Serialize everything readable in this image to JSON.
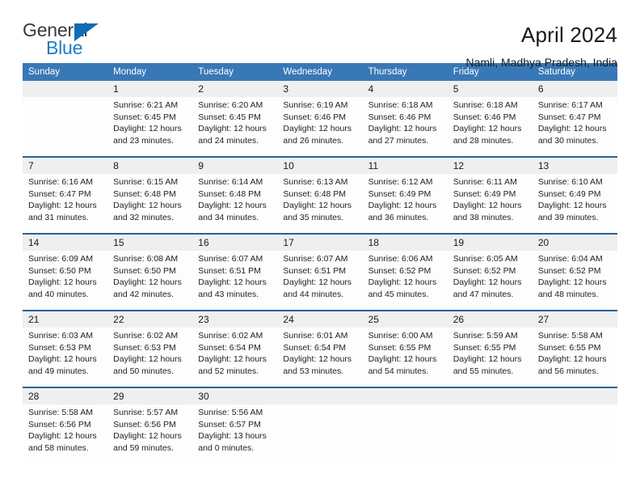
{
  "logo": {
    "word_top": "General",
    "word_bottom": "Blue",
    "triangle_icon": "triangle-icon",
    "brand_blue": "#0f6cb5",
    "brand_gray": "#3a3a3a"
  },
  "header": {
    "title": "April 2024",
    "subtitle": "Namli, Madhya Pradesh, India"
  },
  "theme": {
    "header_bg": "#3878b6",
    "daynum_bg": "#efefef",
    "rule_color": "#2a6099",
    "cell_bg": "#fdfdfd"
  },
  "columns": [
    "Sunday",
    "Monday",
    "Tuesday",
    "Wednesday",
    "Thursday",
    "Friday",
    "Saturday"
  ],
  "weeks": [
    {
      "days": [
        {
          "num": "",
          "lines": []
        },
        {
          "num": "1",
          "lines": [
            "Sunrise: 6:21 AM",
            "Sunset: 6:45 PM",
            "Daylight: 12 hours",
            "and 23 minutes."
          ]
        },
        {
          "num": "2",
          "lines": [
            "Sunrise: 6:20 AM",
            "Sunset: 6:45 PM",
            "Daylight: 12 hours",
            "and 24 minutes."
          ]
        },
        {
          "num": "3",
          "lines": [
            "Sunrise: 6:19 AM",
            "Sunset: 6:46 PM",
            "Daylight: 12 hours",
            "and 26 minutes."
          ]
        },
        {
          "num": "4",
          "lines": [
            "Sunrise: 6:18 AM",
            "Sunset: 6:46 PM",
            "Daylight: 12 hours",
            "and 27 minutes."
          ]
        },
        {
          "num": "5",
          "lines": [
            "Sunrise: 6:18 AM",
            "Sunset: 6:46 PM",
            "Daylight: 12 hours",
            "and 28 minutes."
          ]
        },
        {
          "num": "6",
          "lines": [
            "Sunrise: 6:17 AM",
            "Sunset: 6:47 PM",
            "Daylight: 12 hours",
            "and 30 minutes."
          ]
        }
      ]
    },
    {
      "days": [
        {
          "num": "7",
          "lines": [
            "Sunrise: 6:16 AM",
            "Sunset: 6:47 PM",
            "Daylight: 12 hours",
            "and 31 minutes."
          ]
        },
        {
          "num": "8",
          "lines": [
            "Sunrise: 6:15 AM",
            "Sunset: 6:48 PM",
            "Daylight: 12 hours",
            "and 32 minutes."
          ]
        },
        {
          "num": "9",
          "lines": [
            "Sunrise: 6:14 AM",
            "Sunset: 6:48 PM",
            "Daylight: 12 hours",
            "and 34 minutes."
          ]
        },
        {
          "num": "10",
          "lines": [
            "Sunrise: 6:13 AM",
            "Sunset: 6:48 PM",
            "Daylight: 12 hours",
            "and 35 minutes."
          ]
        },
        {
          "num": "11",
          "lines": [
            "Sunrise: 6:12 AM",
            "Sunset: 6:49 PM",
            "Daylight: 12 hours",
            "and 36 minutes."
          ]
        },
        {
          "num": "12",
          "lines": [
            "Sunrise: 6:11 AM",
            "Sunset: 6:49 PM",
            "Daylight: 12 hours",
            "and 38 minutes."
          ]
        },
        {
          "num": "13",
          "lines": [
            "Sunrise: 6:10 AM",
            "Sunset: 6:49 PM",
            "Daylight: 12 hours",
            "and 39 minutes."
          ]
        }
      ]
    },
    {
      "days": [
        {
          "num": "14",
          "lines": [
            "Sunrise: 6:09 AM",
            "Sunset: 6:50 PM",
            "Daylight: 12 hours",
            "and 40 minutes."
          ]
        },
        {
          "num": "15",
          "lines": [
            "Sunrise: 6:08 AM",
            "Sunset: 6:50 PM",
            "Daylight: 12 hours",
            "and 42 minutes."
          ]
        },
        {
          "num": "16",
          "lines": [
            "Sunrise: 6:07 AM",
            "Sunset: 6:51 PM",
            "Daylight: 12 hours",
            "and 43 minutes."
          ]
        },
        {
          "num": "17",
          "lines": [
            "Sunrise: 6:07 AM",
            "Sunset: 6:51 PM",
            "Daylight: 12 hours",
            "and 44 minutes."
          ]
        },
        {
          "num": "18",
          "lines": [
            "Sunrise: 6:06 AM",
            "Sunset: 6:52 PM",
            "Daylight: 12 hours",
            "and 45 minutes."
          ]
        },
        {
          "num": "19",
          "lines": [
            "Sunrise: 6:05 AM",
            "Sunset: 6:52 PM",
            "Daylight: 12 hours",
            "and 47 minutes."
          ]
        },
        {
          "num": "20",
          "lines": [
            "Sunrise: 6:04 AM",
            "Sunset: 6:52 PM",
            "Daylight: 12 hours",
            "and 48 minutes."
          ]
        }
      ]
    },
    {
      "days": [
        {
          "num": "21",
          "lines": [
            "Sunrise: 6:03 AM",
            "Sunset: 6:53 PM",
            "Daylight: 12 hours",
            "and 49 minutes."
          ]
        },
        {
          "num": "22",
          "lines": [
            "Sunrise: 6:02 AM",
            "Sunset: 6:53 PM",
            "Daylight: 12 hours",
            "and 50 minutes."
          ]
        },
        {
          "num": "23",
          "lines": [
            "Sunrise: 6:02 AM",
            "Sunset: 6:54 PM",
            "Daylight: 12 hours",
            "and 52 minutes."
          ]
        },
        {
          "num": "24",
          "lines": [
            "Sunrise: 6:01 AM",
            "Sunset: 6:54 PM",
            "Daylight: 12 hours",
            "and 53 minutes."
          ]
        },
        {
          "num": "25",
          "lines": [
            "Sunrise: 6:00 AM",
            "Sunset: 6:55 PM",
            "Daylight: 12 hours",
            "and 54 minutes."
          ]
        },
        {
          "num": "26",
          "lines": [
            "Sunrise: 5:59 AM",
            "Sunset: 6:55 PM",
            "Daylight: 12 hours",
            "and 55 minutes."
          ]
        },
        {
          "num": "27",
          "lines": [
            "Sunrise: 5:58 AM",
            "Sunset: 6:55 PM",
            "Daylight: 12 hours",
            "and 56 minutes."
          ]
        }
      ]
    },
    {
      "days": [
        {
          "num": "28",
          "lines": [
            "Sunrise: 5:58 AM",
            "Sunset: 6:56 PM",
            "Daylight: 12 hours",
            "and 58 minutes."
          ]
        },
        {
          "num": "29",
          "lines": [
            "Sunrise: 5:57 AM",
            "Sunset: 6:56 PM",
            "Daylight: 12 hours",
            "and 59 minutes."
          ]
        },
        {
          "num": "30",
          "lines": [
            "Sunrise: 5:56 AM",
            "Sunset: 6:57 PM",
            "Daylight: 13 hours",
            "and 0 minutes."
          ]
        },
        {
          "num": "",
          "lines": []
        },
        {
          "num": "",
          "lines": []
        },
        {
          "num": "",
          "lines": []
        },
        {
          "num": "",
          "lines": []
        }
      ]
    }
  ]
}
